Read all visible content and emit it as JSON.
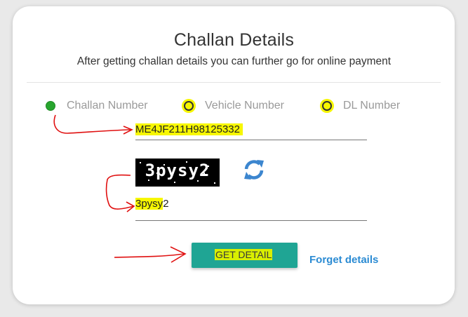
{
  "header": {
    "title": "Challan Details",
    "subtitle": "After getting challan details you can further go for online payment"
  },
  "search_options": [
    {
      "label": "Challan Number",
      "selected": true
    },
    {
      "label": "Vehicle Number",
      "selected": false
    },
    {
      "label": "DL Number",
      "selected": false
    }
  ],
  "challan_input": {
    "value": "ME4JF211H98125332"
  },
  "captcha": {
    "image_text": "3pysy2",
    "refresh_icon": "refresh-icon",
    "entered_highlighted": "3pysy",
    "entered_rest": "2"
  },
  "actions": {
    "submit_label": "GET DETAIL",
    "forget_link": "Forget details"
  },
  "colors": {
    "selected_radio": "#28a52e",
    "button": "#1fa594",
    "link": "#2b8bd3",
    "highlight": "#f7f700",
    "annotation": "#e01010"
  }
}
